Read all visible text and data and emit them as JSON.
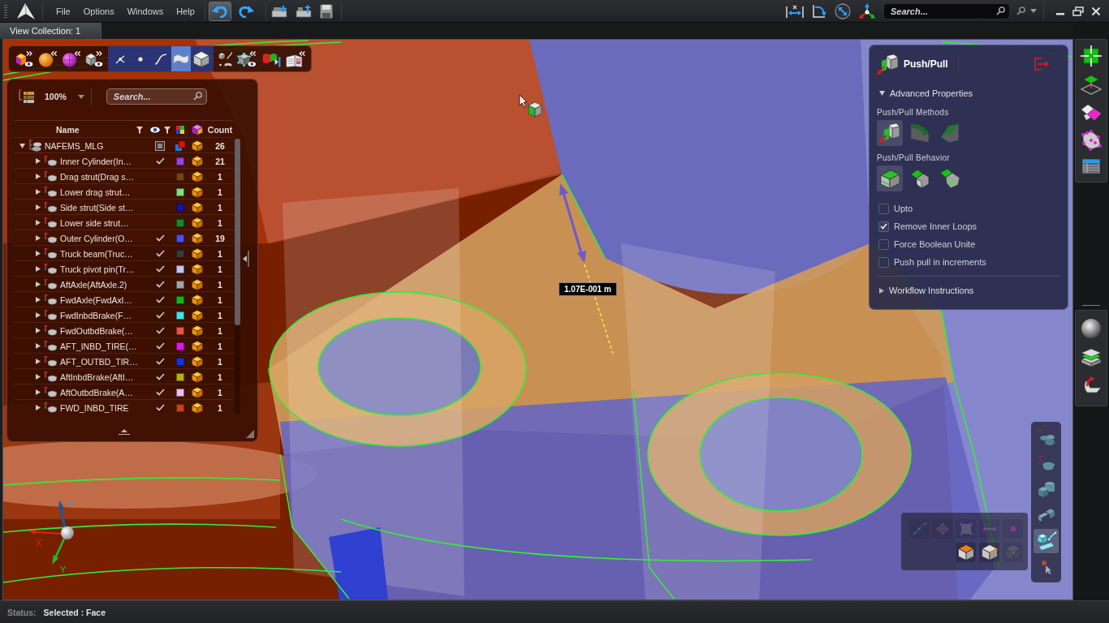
{
  "menu": [
    {
      "label": "File"
    },
    {
      "label": "Options"
    },
    {
      "label": "Windows"
    },
    {
      "label": "Help"
    }
  ],
  "history_buttons": [
    {
      "kind": "undo",
      "pressed": true
    },
    {
      "kind": "redo",
      "pressed": false
    }
  ],
  "search": {
    "placeholder": "Search..."
  },
  "tabs": [
    {
      "label": "View Collection: 1",
      "selected": true
    }
  ],
  "selection_types": [
    {
      "kind": "vertex",
      "selected": false
    },
    {
      "kind": "point",
      "selected": false
    },
    {
      "kind": "curve",
      "selected": false
    },
    {
      "kind": "surface",
      "selected": true
    },
    {
      "kind": "solid",
      "selected": false
    }
  ],
  "tree_panel": {
    "zoom": "100%",
    "search": {
      "placeholder": "Search..."
    },
    "columns": {
      "name": "Name",
      "count": "Count"
    },
    "root": {
      "name": "NAFEMS_MLG",
      "expanded": true,
      "mixed": true,
      "count": "26",
      "children": [
        {
          "name": "Inner Cylinder(In…",
          "expanded": false,
          "visible": true,
          "color": "#a040e0",
          "count": "21"
        },
        {
          "name": "Drag strut(Drag s…",
          "expanded": false,
          "visible": false,
          "color": "#7a4212",
          "count": "1"
        },
        {
          "name": "Lower drag strut…",
          "expanded": false,
          "visible": false,
          "color": "#80e080",
          "count": "1"
        },
        {
          "name": "Side strut(Side st…",
          "expanded": false,
          "visible": false,
          "color": "#1414a0",
          "count": "1"
        },
        {
          "name": "Lower side strut…",
          "expanded": false,
          "visible": false,
          "color": "#148a24",
          "count": "1"
        },
        {
          "name": "Outer Cylinder(O…",
          "expanded": false,
          "visible": true,
          "color": "#4a52e8",
          "count": "19"
        },
        {
          "name": "Truck beam(Truc…",
          "expanded": false,
          "visible": true,
          "color": "#3a3a3a",
          "count": "1"
        },
        {
          "name": "Truck pivot pin(Tr…",
          "expanded": false,
          "visible": true,
          "color": "#c4c4f4",
          "count": "1"
        },
        {
          "name": "AftAxle(AftAxle.2)",
          "expanded": false,
          "visible": true,
          "color": "#a4a4a4",
          "count": "1"
        },
        {
          "name": "FwdAxle(FwdAxl…",
          "expanded": false,
          "visible": true,
          "color": "#12b812",
          "count": "1"
        },
        {
          "name": "FwdInbdBrake(F…",
          "expanded": false,
          "visible": true,
          "color": "#44e4e4",
          "count": "1"
        },
        {
          "name": "FwdOutbdBrake(…",
          "expanded": false,
          "visible": true,
          "color": "#e85444",
          "count": "1"
        },
        {
          "name": "AFT_INBD_TIRE(…",
          "expanded": false,
          "visible": true,
          "color": "#e414e4",
          "count": "1"
        },
        {
          "name": "AFT_OUTBD_TIR…",
          "expanded": false,
          "visible": true,
          "color": "#1434e4",
          "count": "1"
        },
        {
          "name": "AftInbdBrake(AftI…",
          "expanded": false,
          "visible": true,
          "color": "#b4b400",
          "count": "1"
        },
        {
          "name": "AftOutbdBrake(A…",
          "expanded": false,
          "visible": true,
          "color": "#ecbcec",
          "count": "1"
        },
        {
          "name": "FWD_INBD_TIRE",
          "expanded": false,
          "visible": true,
          "color": "#c44414",
          "count": "1"
        }
      ]
    }
  },
  "viewport": {
    "dimension": "1.07E-001 m",
    "axes": [
      {
        "label": "X"
      },
      {
        "label": "Y"
      },
      {
        "label": "Z"
      }
    ]
  },
  "push_pull": {
    "title": "Push/Pull",
    "advanced": {
      "title": "Advanced Properties",
      "expanded": true,
      "groups": [
        {
          "label": "Push/Pull Methods",
          "options": [
            {
              "kind": "extrude",
              "selected": true
            },
            {
              "kind": "round",
              "selected": false
            },
            {
              "kind": "chamfer",
              "selected": false
            }
          ]
        },
        {
          "label": "Push/Pull Behavior",
          "options": [
            {
              "kind": "face",
              "selected": true
            },
            {
              "kind": "offset",
              "selected": false
            },
            {
              "kind": "tilt",
              "selected": false
            }
          ]
        }
      ],
      "checkboxes": [
        {
          "label": "Upto",
          "checked": false
        },
        {
          "label": "Remove Inner Loops",
          "checked": true
        },
        {
          "label": "Force Boolean Unite",
          "checked": false
        },
        {
          "label": "Push pull in increments",
          "checked": false
        }
      ]
    },
    "workflow": {
      "title": "Workflow Instructions",
      "expanded": false
    }
  },
  "view_tools": [
    {
      "kind": "assembly",
      "selected": false
    },
    {
      "kind": "part",
      "selected": false
    },
    {
      "kind": "bodies",
      "selected": false
    },
    {
      "kind": "faces",
      "selected": false
    },
    {
      "kind": "mixed",
      "selected": true
    },
    {
      "kind": "pick",
      "selected": false
    }
  ],
  "selection_filters": {
    "rows": [
      [
        {
          "kind": "curve_points",
          "enabled": false
        },
        {
          "kind": "circle_points",
          "enabled": false
        },
        {
          "kind": "square_points",
          "enabled": false
        },
        {
          "kind": "line_points",
          "enabled": false
        },
        {
          "kind": "point",
          "enabled": false
        }
      ],
      [
        {
          "kind": "face",
          "enabled": true
        },
        {
          "kind": "edge",
          "enabled": true
        },
        {
          "kind": "vertex",
          "enabled": false
        }
      ]
    ]
  },
  "status_bar": {
    "label": "Status:",
    "value": "Selected : Face"
  }
}
